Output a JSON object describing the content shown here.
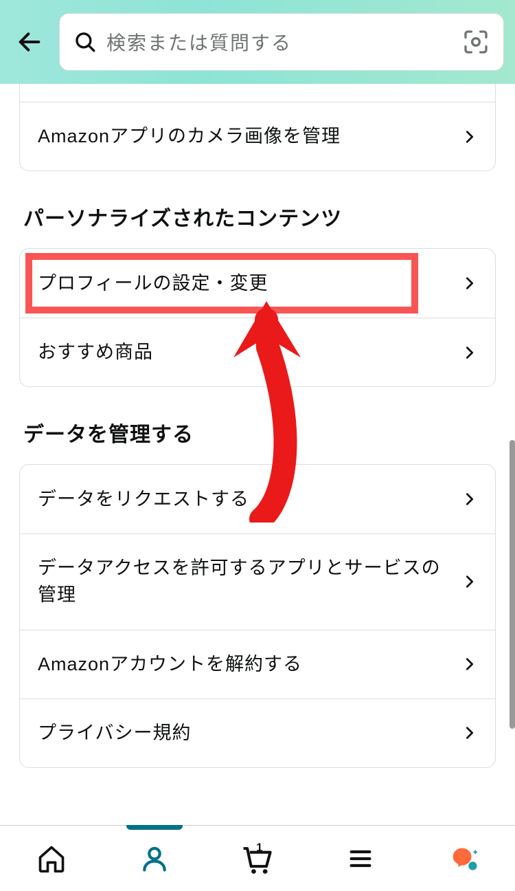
{
  "header": {
    "search_placeholder": "検索または質問する"
  },
  "partial_group": {
    "items": [
      {
        "label": ""
      },
      {
        "label": "Amazonアプリのカメラ画像を管理"
      }
    ]
  },
  "section1": {
    "title": "パーソナライズされたコンテンツ",
    "items": [
      {
        "label": "プロフィールの設定・変更",
        "highlighted": true
      },
      {
        "label": "おすすめ商品"
      }
    ]
  },
  "section2": {
    "title": "データを管理する",
    "items": [
      {
        "label": "データをリクエストする"
      },
      {
        "label": "データアクセスを許可するアプリとサービスの管理"
      },
      {
        "label": "Amazonアカウントを解約する"
      },
      {
        "label": "プライバシー規約"
      }
    ]
  },
  "nav": {
    "cart_count": "1"
  }
}
